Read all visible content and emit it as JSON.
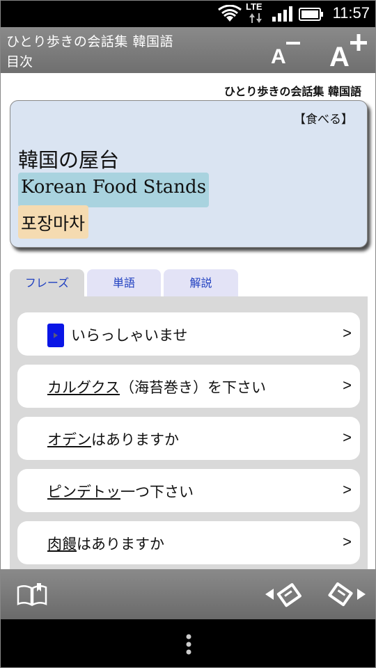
{
  "status_bar": {
    "network": "LTE",
    "time": "11:57"
  },
  "title_bar": {
    "title": "ひとり歩きの会話集 韓国語",
    "subtitle": "目次"
  },
  "header": {
    "book_label": "ひとり歩きの会話集 韓国語"
  },
  "card": {
    "category": "【食べる】",
    "jp_title": "韓国の屋台",
    "en_title": "Korean Food Stands",
    "ko_title": "포장마차"
  },
  "tabs": [
    {
      "label": "フレーズ",
      "active": true
    },
    {
      "label": "単語",
      "active": false
    },
    {
      "label": "解説",
      "active": false
    }
  ],
  "phrases": [
    {
      "underlined": "",
      "rest": "いらっしゃいませ",
      "has_audio": true,
      "chevron": ">"
    },
    {
      "underlined": "カルグクス",
      "rest": "（海苔巻き）を下さい",
      "has_audio": false,
      "chevron": ">"
    },
    {
      "underlined": "オデン",
      "rest": "はありますか",
      "has_audio": false,
      "chevron": ">"
    },
    {
      "underlined": "ピンデトッ",
      "rest": "一つ下さい",
      "has_audio": false,
      "chevron": ">"
    },
    {
      "underlined": "肉饅",
      "rest": "はありますか",
      "has_audio": false,
      "chevron": ">"
    }
  ],
  "icons": {
    "font_decrease": "font-decrease-icon",
    "font_increase": "font-increase-icon",
    "toc": "book-icon",
    "prev": "prev-page-icon",
    "next": "next-page-icon",
    "menu": "overflow-menu-icon"
  },
  "colors": {
    "card_bg": "#dae4f2",
    "en_highlight": "#a9d3df",
    "ko_highlight": "#f5dbb1",
    "tab_text": "#2040c0",
    "audio_button": "#0a16e6"
  }
}
